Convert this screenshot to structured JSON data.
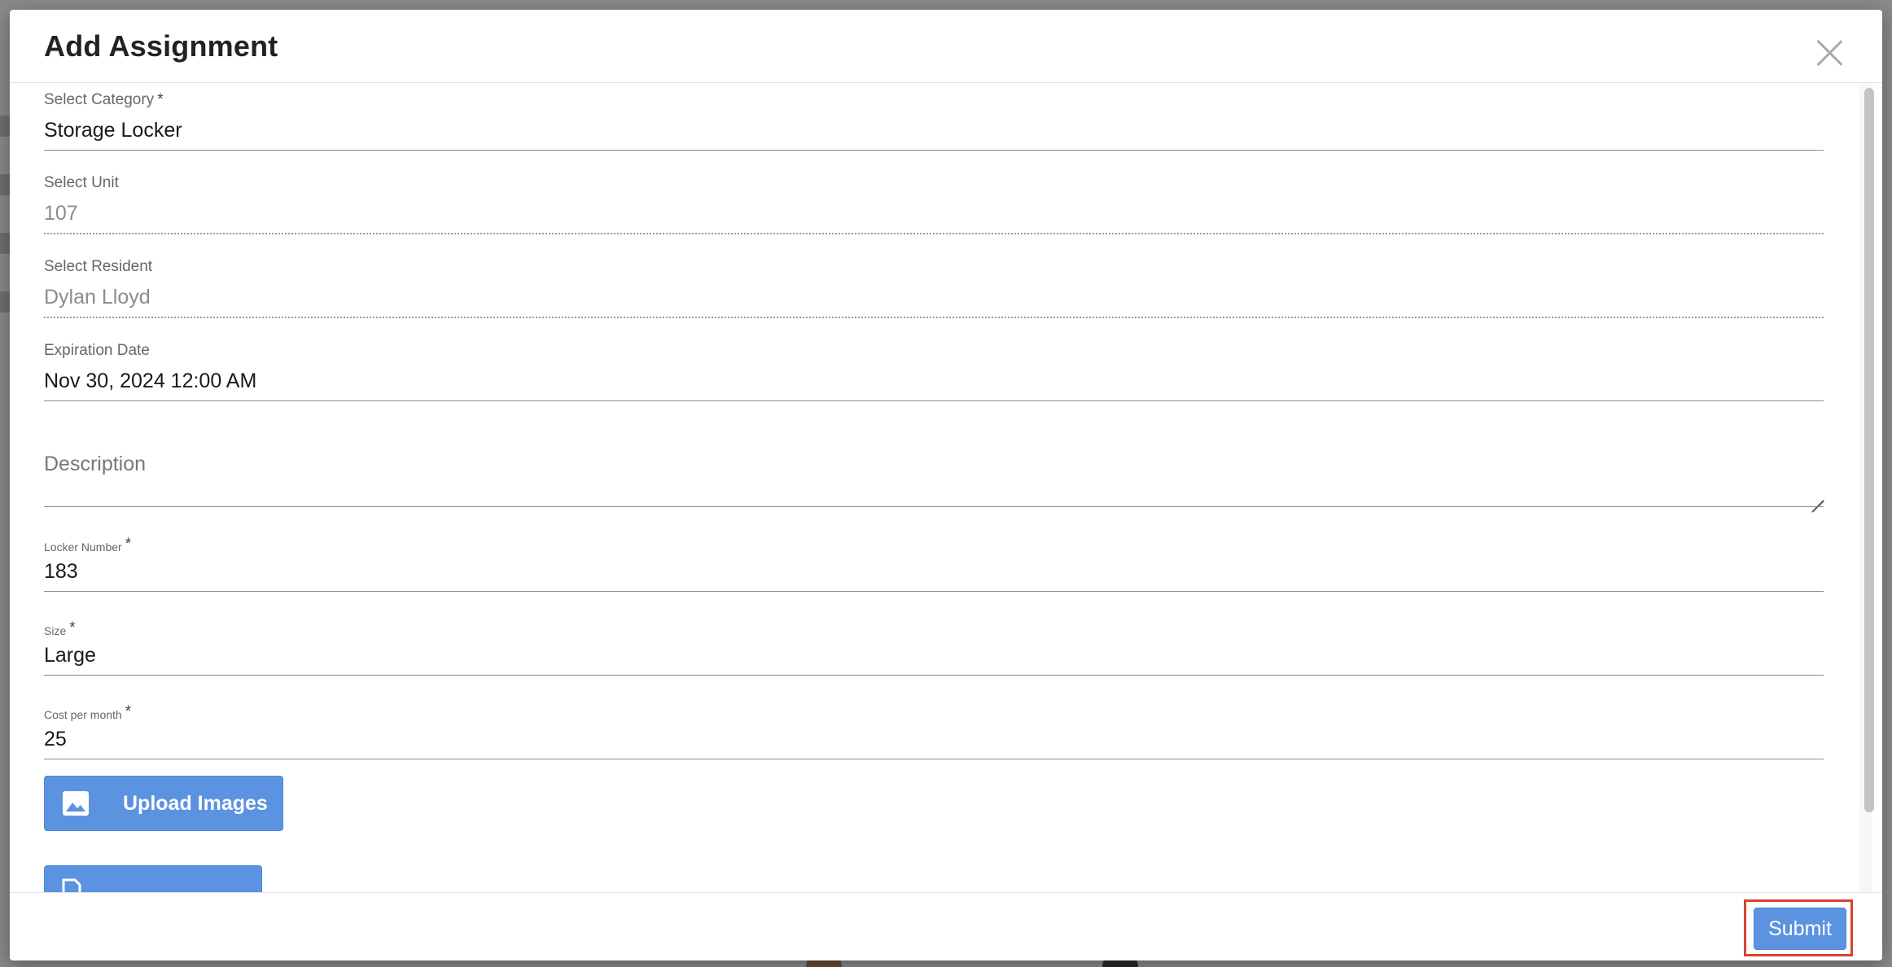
{
  "modal": {
    "title": "Add Assignment",
    "close_icon": "close-icon"
  },
  "form": {
    "category": {
      "label": "Select Category",
      "required": "*",
      "value": "Storage Locker"
    },
    "unit": {
      "label": "Select Unit",
      "value": "107"
    },
    "resident": {
      "label": "Select Resident",
      "value": "Dylan Lloyd"
    },
    "expiration": {
      "label": "Expiration Date",
      "value": "Nov 30, 2024 12:00 AM"
    },
    "description": {
      "placeholder": "Description"
    },
    "locker_number": {
      "label": "Locker Number",
      "required": "*",
      "value": "183"
    },
    "size": {
      "label": "Size",
      "required": "*",
      "value": "Large"
    },
    "cost": {
      "label": "Cost per month",
      "required": "*",
      "value": "25"
    }
  },
  "buttons": {
    "upload_images": "Upload Images",
    "upload_icon": "image-icon",
    "second_icon": "document-icon",
    "submit": "Submit"
  },
  "colors": {
    "primary": "#5b93e0",
    "highlight": "#d9432f",
    "overlay": "#8a8a8a"
  }
}
